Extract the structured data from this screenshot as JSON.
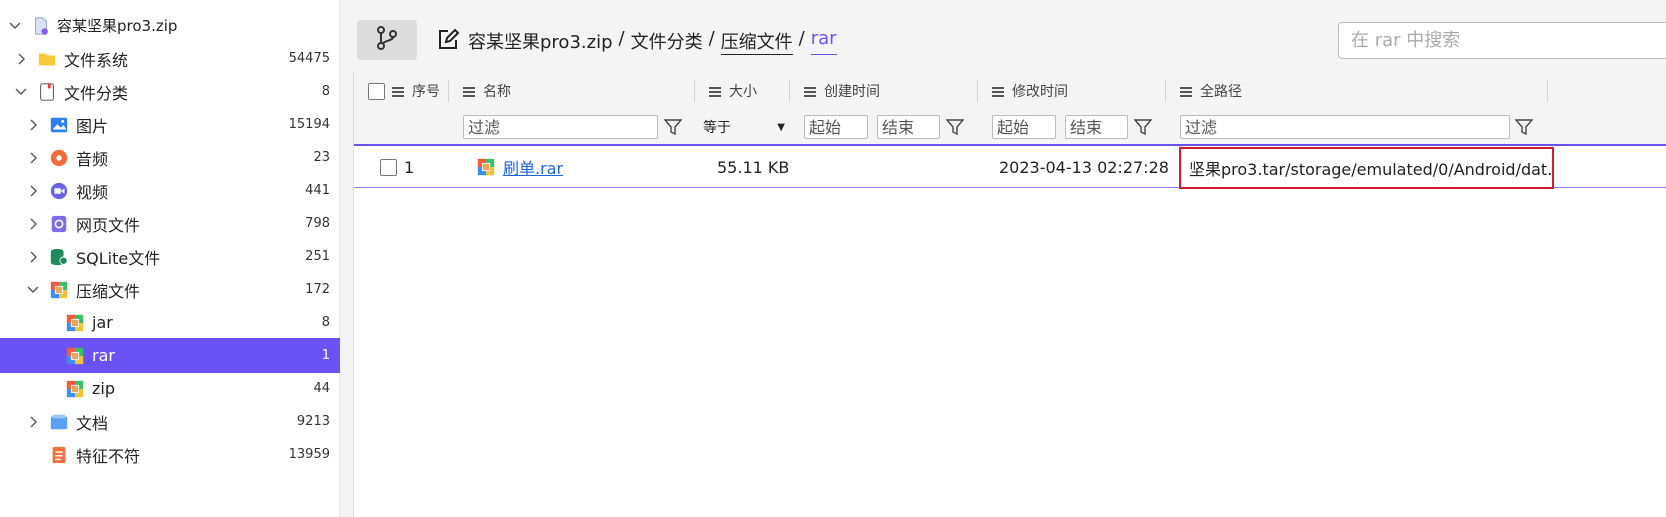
{
  "sidebar": {
    "root": {
      "label": "容某坚果pro3.zip",
      "icon": "zip-file-icon"
    },
    "items": [
      {
        "label": "文件系统",
        "count": "54475",
        "icon": "folder-icon"
      },
      {
        "label": "文件分类",
        "count": "8",
        "icon": "file-classify-icon"
      },
      {
        "label": "图片",
        "count": "15194",
        "icon": "image-icon"
      },
      {
        "label": "音频",
        "count": "23",
        "icon": "audio-icon"
      },
      {
        "label": "视频",
        "count": "441",
        "icon": "video-icon"
      },
      {
        "label": "网页文件",
        "count": "798",
        "icon": "webpage-icon"
      },
      {
        "label": "SQLite文件",
        "count": "251",
        "icon": "database-icon"
      },
      {
        "label": "压缩文件",
        "count": "172",
        "icon": "archive-icon"
      },
      {
        "label": "jar",
        "count": "8",
        "icon": "archive-icon"
      },
      {
        "label": "rar",
        "count": "1",
        "icon": "archive-icon"
      },
      {
        "label": "zip",
        "count": "44",
        "icon": "archive-icon"
      },
      {
        "label": "文档",
        "count": "9213",
        "icon": "document-icon"
      },
      {
        "label": "特征不符",
        "count": "13959",
        "icon": "mismatch-icon"
      }
    ]
  },
  "breadcrumb": {
    "parts": [
      "容某坚果pro3.zip",
      "文件分类",
      "压缩文件",
      "rar"
    ],
    "separator": "/"
  },
  "search": {
    "placeholder": "在 rar 中搜索"
  },
  "table": {
    "columns": [
      "序号",
      "名称",
      "大小",
      "创建时间",
      "修改时间",
      "全路径"
    ],
    "filters": {
      "name_placeholder": "过滤",
      "size_op": "等于",
      "start_placeholder": "起始",
      "end_placeholder": "结束",
      "mod_start_placeholder": "起始",
      "mod_end_placeholder": "结束",
      "path_placeholder": "过滤"
    },
    "rows": [
      {
        "index": "1",
        "name": "刷单.rar",
        "size": "55.11 KB",
        "created": "",
        "modified": "2023-04-13 02:27:28",
        "path": "坚果pro3.tar/storage/emulated/0/Android/dat..."
      }
    ]
  },
  "colors": {
    "accent": "#6b52f5",
    "highlight_border": "#d41c2a",
    "link": "#1b63d8"
  }
}
